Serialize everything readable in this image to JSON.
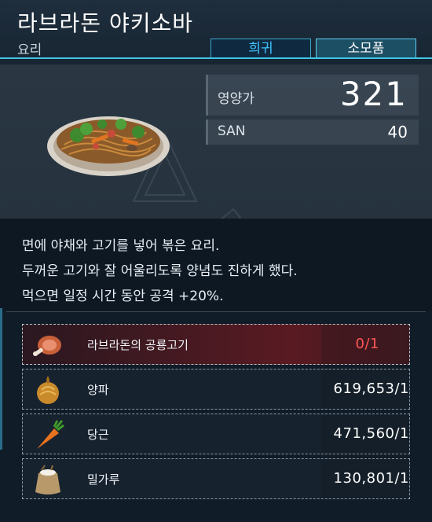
{
  "item": {
    "name": "라브라돈 야키소바",
    "category": "요리",
    "rarity": "희귀",
    "type": "소모품"
  },
  "stats": {
    "nutrition_label": "영양가",
    "nutrition_value": "321",
    "san_label": "SAN",
    "san_value": "40"
  },
  "description": [
    "면에 야채와 고기를 넣어 볶은 요리.",
    "두꺼운 고기와 잘 어울리도록 양념도 진하게 했다.",
    "먹으면 일정 시간 동안 공격 +20%."
  ],
  "materials": [
    {
      "name": "라브라돈의 공룡고기",
      "count": "0/1",
      "icon": "meat-icon",
      "sufficient": false
    },
    {
      "name": "양파",
      "count": "619,653/1",
      "icon": "onion-icon",
      "sufficient": true
    },
    {
      "name": "당근",
      "count": "471,560/1",
      "icon": "carrot-icon",
      "sufficient": true
    },
    {
      "name": "밀가루",
      "count": "130,801/1",
      "icon": "flour-sack-icon",
      "sufficient": true
    }
  ],
  "colors": {
    "accent": "#3fc4e6",
    "rarity": "#3fc4ff",
    "insufficient": "#ff5656"
  }
}
